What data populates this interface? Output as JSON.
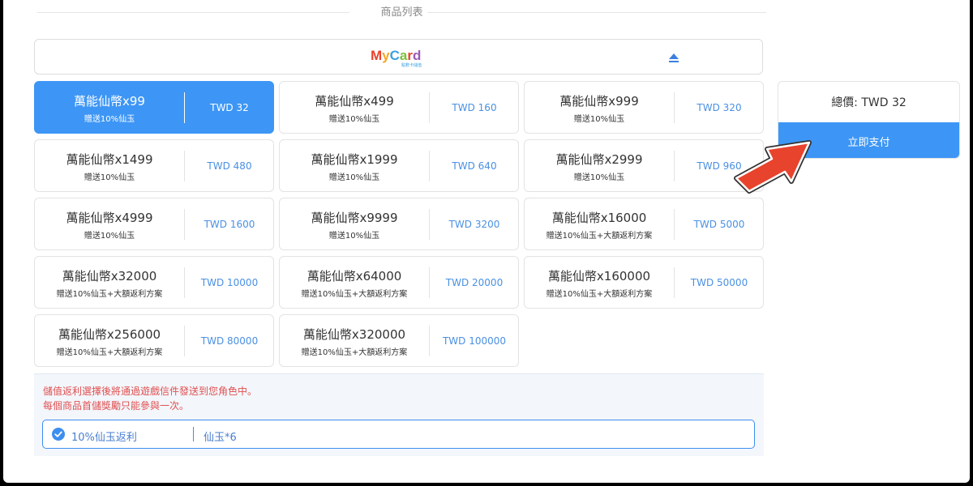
{
  "section_title": "商品列表",
  "payment_method": {
    "logo_text": "MyCard",
    "logo_subtext": "點數卡儲值"
  },
  "products": [
    {
      "name": "萬能仙幣x99",
      "bonus": "贈送10%仙玉",
      "price": "TWD 32",
      "selected": true
    },
    {
      "name": "萬能仙幣x499",
      "bonus": "贈送10%仙玉",
      "price": "TWD 160"
    },
    {
      "name": "萬能仙幣x999",
      "bonus": "贈送10%仙玉",
      "price": "TWD 320"
    },
    {
      "name": "萬能仙幣x1499",
      "bonus": "贈送10%仙玉",
      "price": "TWD 480"
    },
    {
      "name": "萬能仙幣x1999",
      "bonus": "贈送10%仙玉",
      "price": "TWD 640"
    },
    {
      "name": "萬能仙幣x2999",
      "bonus": "贈送10%仙玉",
      "price": "TWD 960"
    },
    {
      "name": "萬能仙幣x4999",
      "bonus": "贈送10%仙玉",
      "price": "TWD 1600"
    },
    {
      "name": "萬能仙幣x9999",
      "bonus": "贈送10%仙玉",
      "price": "TWD 3200"
    },
    {
      "name": "萬能仙幣x16000",
      "bonus": "贈送10%仙玉+大額返利方案",
      "price": "TWD 5000"
    },
    {
      "name": "萬能仙幣x32000",
      "bonus": "贈送10%仙玉+大額返利方案",
      "price": "TWD 10000"
    },
    {
      "name": "萬能仙幣x64000",
      "bonus": "贈送10%仙玉+大額返利方案",
      "price": "TWD 20000"
    },
    {
      "name": "萬能仙幣x160000",
      "bonus": "贈送10%仙玉+大額返利方案",
      "price": "TWD 50000"
    },
    {
      "name": "萬能仙幣x256000",
      "bonus": "贈送10%仙玉+大額返利方案",
      "price": "TWD 80000"
    },
    {
      "name": "萬能仙幣x320000",
      "bonus": "贈送10%仙玉+大額返利方案",
      "price": "TWD 100000"
    }
  ],
  "notice": {
    "line1": "儲值返利選擇後將通過遊戲信件發送到您角色中。",
    "line2": "每個商品首儲獎勵只能參與一次。"
  },
  "rebate": {
    "label": "10%仙玉返利",
    "value": "仙玉*6",
    "checked": true
  },
  "summary": {
    "total": "總價: TWD 32",
    "pay_label": "立即支付"
  },
  "colors": {
    "accent": "#3d96f5",
    "price_text": "#4a90e2",
    "notice_text": "#e05050",
    "arrow": "#e8432d"
  },
  "icons": {
    "collapse": "triangle-up-icon",
    "check": "check-circle-icon",
    "annotation": "arrow-pointer-icon"
  }
}
